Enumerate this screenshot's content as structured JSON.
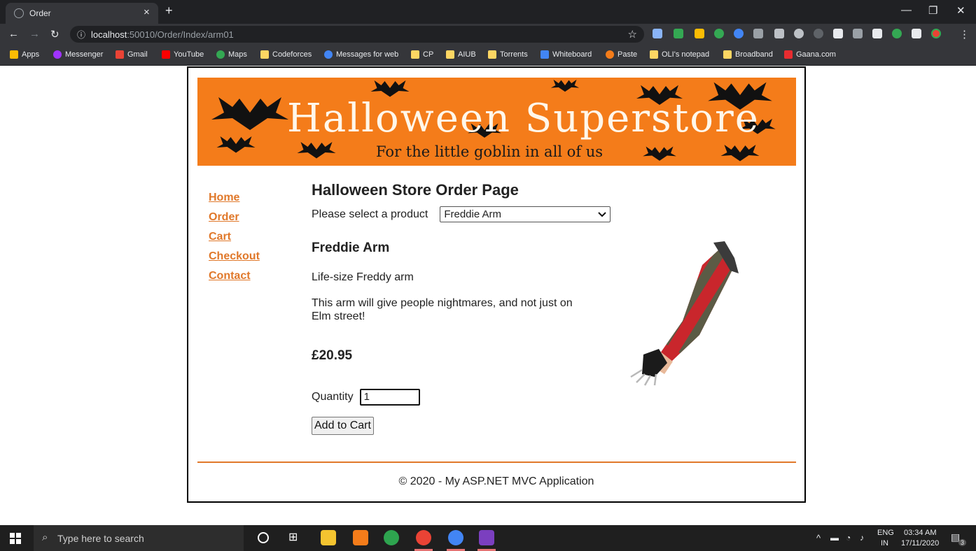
{
  "browser": {
    "tab_title": "Order",
    "tab_close": "×",
    "new_tab": "+",
    "url_host": "localhost",
    "url_path": ":50010/Order/Index/arm01",
    "bookmarks": [
      "Apps",
      "Messenger",
      "Gmail",
      "YouTube",
      "Maps",
      "Codeforces",
      "Messages for web",
      "CP",
      "AIUB",
      "Torrents",
      "Whiteboard",
      "Paste",
      "OLI's notepad",
      "Broadband",
      "Gaana.com"
    ]
  },
  "banner": {
    "title": "Halloween Superstore",
    "tagline": "For the little goblin in all of us"
  },
  "nav": {
    "home": "Home",
    "order": "Order",
    "cart": "Cart",
    "checkout": "Checkout",
    "contact": "Contact"
  },
  "order": {
    "heading": "Halloween Store Order Page",
    "select_label": "Please select a product",
    "selected_product": "Freddie Arm",
    "product_name": "Freddie Arm",
    "short_description": "Life-size Freddy arm",
    "long_description": "This arm will give people nightmares, and not just on Elm street!",
    "price": "£20.95",
    "quantity_label": "Quantity",
    "quantity_value": "1",
    "add_button": "Add to Cart"
  },
  "footer": {
    "text": "© 2020 - My ASP.NET MVC Application"
  },
  "taskbar": {
    "search_placeholder": "Type here to search",
    "lang_top": "ENG",
    "lang_bottom": "IN",
    "time": "03:34 AM",
    "date": "17/11/2020",
    "notif_count": "3"
  },
  "colors": {
    "banner_bg": "#f47c1a",
    "nav_link": "#e0782a",
    "chrome_dark": "#202124",
    "chrome_toolbar": "#35363a"
  }
}
